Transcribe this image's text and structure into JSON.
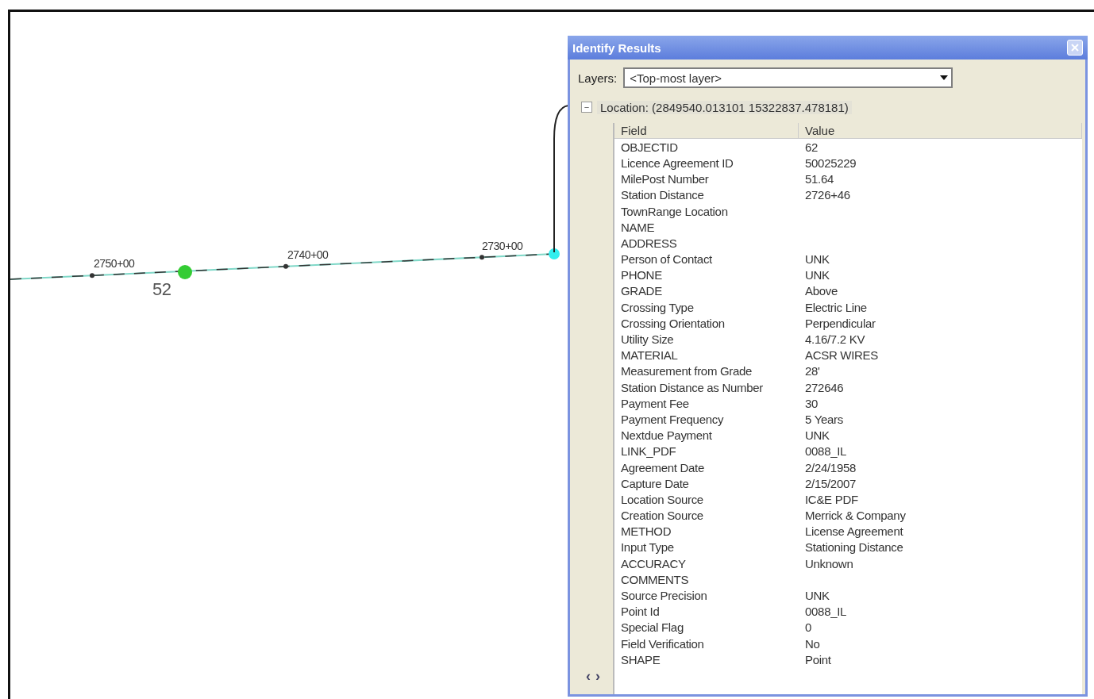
{
  "map": {
    "stations": [
      {
        "label": "2750+00"
      },
      {
        "label": "2740+00"
      },
      {
        "label": "2730+00"
      }
    ],
    "point_label": "52"
  },
  "window": {
    "title": "Identify Results",
    "layers": {
      "label": "Layers:",
      "value": "<Top-most layer>"
    },
    "location": {
      "toggle": "−",
      "text": "Location: (2849540.013101 15322837.478181)",
      "expanded": true
    },
    "table": {
      "columns": [
        "Field",
        "Value"
      ],
      "rows": [
        {
          "field": "OBJECTID",
          "value": "62"
        },
        {
          "field": "Licence Agreement ID",
          "value": "50025229"
        },
        {
          "field": "MilePost Number",
          "value": "51.64"
        },
        {
          "field": "Station Distance",
          "value": "2726+46"
        },
        {
          "field": "TownRange Location"
        },
        {
          "field": "NAME"
        },
        {
          "field": "ADDRESS"
        },
        {
          "field": "Person of Contact",
          "value": "UNK"
        },
        {
          "field": "PHONE",
          "value": "UNK"
        },
        {
          "field": "GRADE",
          "value": "Above"
        },
        {
          "field": "Crossing Type",
          "value": "Electric Line"
        },
        {
          "field": "Crossing Orientation",
          "value": "Perpendicular"
        },
        {
          "field": "Utility Size",
          "value": "4.16/7.2 KV"
        },
        {
          "field": "MATERIAL",
          "value": "ACSR WIRES"
        },
        {
          "field": "Measurement from Grade",
          "value": "28'"
        },
        {
          "field": "Station Distance as Number",
          "value": "272646"
        },
        {
          "field": "Payment Fee",
          "value": "30"
        },
        {
          "field": "Payment Frequency",
          "value": "5 Years"
        },
        {
          "field": "Nextdue Payment",
          "value": "UNK"
        },
        {
          "field": "LINK_PDF",
          "value": "0088_IL"
        },
        {
          "field": "Agreement Date",
          "value": "2/24/1958"
        },
        {
          "field": "Capture Date",
          "value": "2/15/2007"
        },
        {
          "field": "Location Source",
          "value": "IC&E PDF"
        },
        {
          "field": "Creation Source",
          "value": "Merrick & Company"
        },
        {
          "field": "METHOD",
          "value": "License Agreement"
        },
        {
          "field": "Input Type",
          "value": "Stationing Distance"
        },
        {
          "field": "ACCURACY",
          "value": "Unknown"
        },
        {
          "field": "COMMENTS"
        },
        {
          "field": "Source Precision",
          "value": "UNK"
        },
        {
          "field": "Point Id",
          "value": "0088_IL"
        },
        {
          "field": "Special Flag",
          "value": "0"
        },
        {
          "field": "Field Verification",
          "value": "No"
        },
        {
          "field": "SHAPE",
          "value": "Point"
        }
      ]
    },
    "scroll": {
      "left": "‹",
      "right": "›"
    }
  }
}
